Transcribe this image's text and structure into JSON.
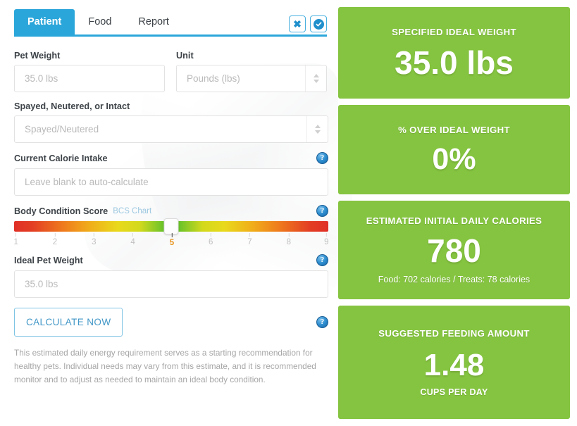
{
  "tabs": [
    {
      "label": "Patient",
      "active": true
    },
    {
      "label": "Food",
      "active": false
    },
    {
      "label": "Report",
      "active": false
    }
  ],
  "tab_actions": {
    "close_icon": "close-icon",
    "confirm_icon": "check-circle-icon"
  },
  "form": {
    "pet_weight": {
      "label": "Pet Weight",
      "placeholder": "35.0 lbs",
      "value": ""
    },
    "unit": {
      "label": "Unit",
      "value": "Pounds (lbs)"
    },
    "reproductive_status": {
      "label": "Spayed, Neutered, or Intact",
      "value": "Spayed/Neutered"
    },
    "current_calorie_intake": {
      "label": "Current Calorie Intake",
      "placeholder": "Leave blank to auto-calculate",
      "value": "",
      "help_icon": "help-icon"
    },
    "body_condition_score": {
      "label": "Body Condition Score",
      "chart_link": "BCS Chart",
      "help_icon": "help-icon",
      "selected": 5,
      "ticks": [
        "1",
        "2",
        "3",
        "4",
        "5",
        "6",
        "7",
        "8",
        "9"
      ]
    },
    "ideal_pet_weight": {
      "label": "Ideal Pet Weight",
      "placeholder": "35.0 lbs",
      "value": "",
      "help_icon": "help-icon"
    },
    "calculate_button": {
      "label": "CALCULATE NOW",
      "help_icon": "help-icon"
    },
    "disclaimer": "This estimated daily energy requirement serves as a starting recommendation for healthy pets. Individual needs may vary from this estimate, and it is recommended monitor and to adjust as needed to maintain an ideal body condition."
  },
  "results": {
    "specified_ideal_weight": {
      "title": "SPECIFIED IDEAL WEIGHT",
      "value": "35.0 lbs"
    },
    "percent_over_ideal_weight": {
      "title": "% OVER IDEAL WEIGHT",
      "value": "0%"
    },
    "estimated_daily_calories": {
      "title": "ESTIMATED INITIAL DAILY CALORIES",
      "value": "780",
      "breakdown": "Food: 702 calories / Treats: 78 calories"
    },
    "suggested_feeding_amount": {
      "title": "SUGGESTED FEEDING AMOUNT",
      "value": "1.48",
      "unit": "CUPS PER DAY"
    }
  },
  "colors": {
    "accent_blue": "#2ba6da",
    "result_green": "#85c440",
    "bcs_selected_orange": "#e8941f"
  }
}
